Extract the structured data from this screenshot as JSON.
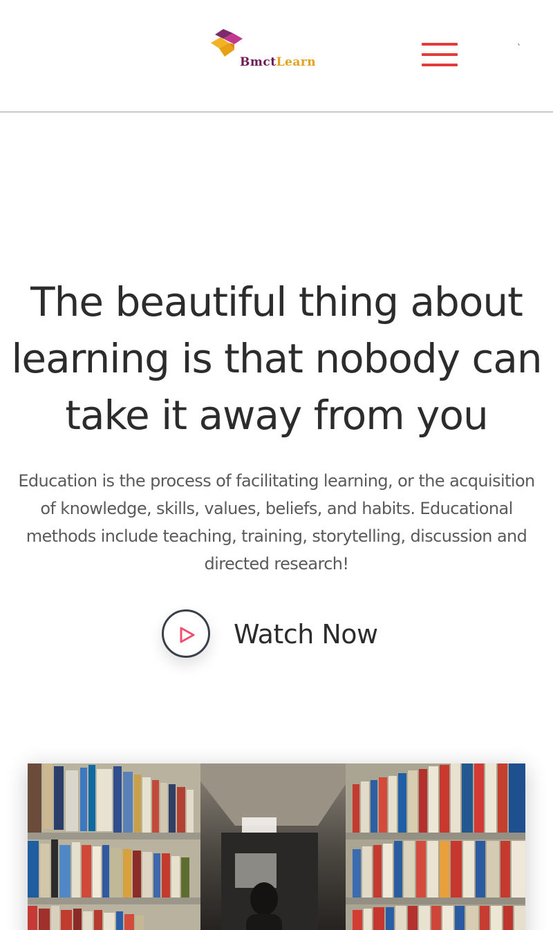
{
  "header": {
    "logo": {
      "text_part1": "Bmct",
      "text_part2": "Learn",
      "alt": "BmctLearn"
    },
    "menu_icon": "hamburger-menu-icon",
    "tick_mark": "`"
  },
  "hero": {
    "title": "The beautiful thing about learning is that nobody can take it away from you",
    "description": "Education is the process of facilitating learning, or the acquisition of knowledge, skills, values, beliefs, and habits. Educational methods include teaching, training, storytelling, discussion and directed research!",
    "watch_label": "Watch Now",
    "play_icon": "play-icon"
  },
  "image": {
    "subject": "library-bookshelves-photo"
  },
  "colors": {
    "accent_red": "#e33b3b",
    "logo_purple": "#6b1a55",
    "logo_gold": "#e4a11b",
    "play_pink": "#f0506e",
    "text_dark": "#2c2c2c",
    "text_muted": "#5a5a5a"
  }
}
